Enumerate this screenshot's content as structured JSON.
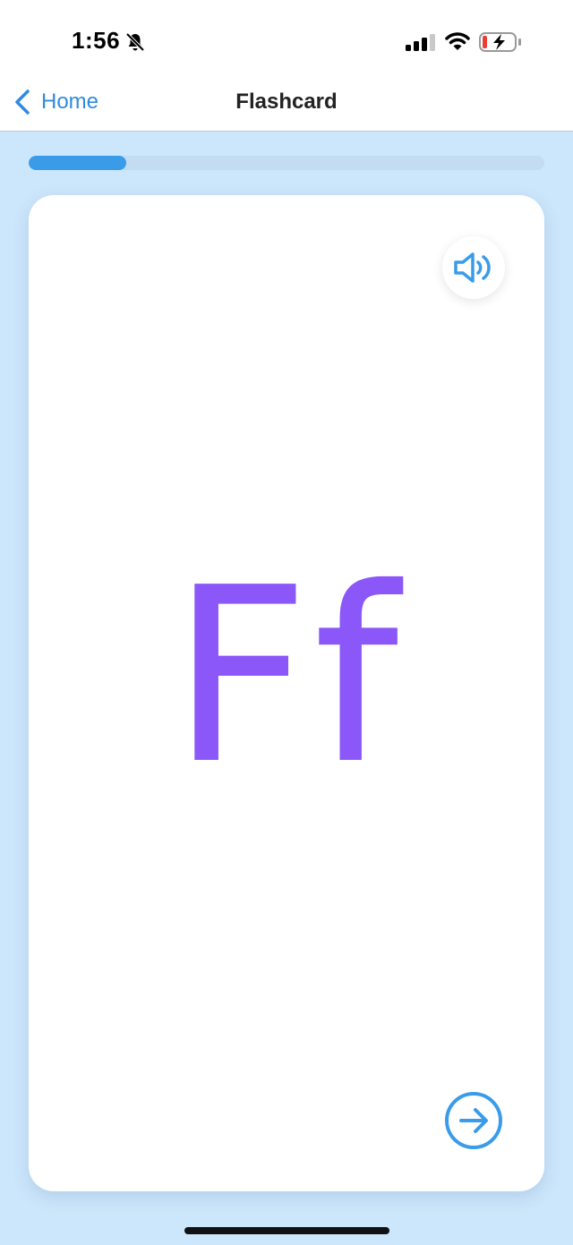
{
  "status_bar": {
    "time": "1:56",
    "icons": [
      "bell-slash-icon",
      "signal-icon",
      "wifi-icon",
      "battery-charging-icon"
    ]
  },
  "nav": {
    "back_label": "Home",
    "title": "Flashcard"
  },
  "progress": {
    "fraction": 0.19
  },
  "card": {
    "letter": "Ff",
    "audio_icon": "speaker-icon",
    "next_icon": "arrow-right-circle-icon"
  },
  "colors": {
    "background": "#cce6fb",
    "accent": "#3a9ce9",
    "letter": "#8b57f8",
    "nav_link": "#2f8be0"
  }
}
